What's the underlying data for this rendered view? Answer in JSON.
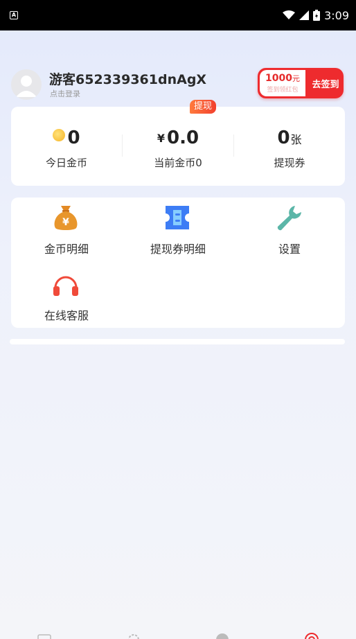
{
  "status_bar": {
    "left_icon": "A",
    "time": "3:09",
    "icons": [
      "wifi-icon",
      "signal-icon",
      "battery-icon"
    ]
  },
  "profile": {
    "username": "游客652339361dnAgX",
    "login_hint": "点击登录"
  },
  "signin": {
    "amount": "1000",
    "unit": "元",
    "subtitle": "签到领红包",
    "button_label": "去签到"
  },
  "stats": {
    "today_coins": {
      "value": "0",
      "label": "今日金币"
    },
    "current_coins": {
      "currency": "¥",
      "value": "0.0",
      "label": "当前金币0",
      "badge": "提现"
    },
    "vouchers": {
      "value": "0",
      "unit": "张",
      "label": "提现券"
    }
  },
  "menu": {
    "items": [
      {
        "label": "金币明细",
        "icon": "money-bag-icon"
      },
      {
        "label": "提现券明细",
        "icon": "ticket-icon"
      },
      {
        "label": "设置",
        "icon": "wrench-icon"
      },
      {
        "label": "在线客服",
        "icon": "headphones-icon"
      }
    ]
  },
  "tabbar": {
    "tabs": [
      {
        "icon": "profile-card-icon"
      },
      {
        "icon": "gear-icon"
      },
      {
        "icon": "message-icon"
      },
      {
        "icon": "target-icon",
        "active": true
      }
    ]
  },
  "colors": {
    "accent_red": "#ee2b2e",
    "coin_orange": "#e8962c",
    "ticket_blue": "#3d7df5",
    "wrench_teal": "#5bb6a8"
  }
}
